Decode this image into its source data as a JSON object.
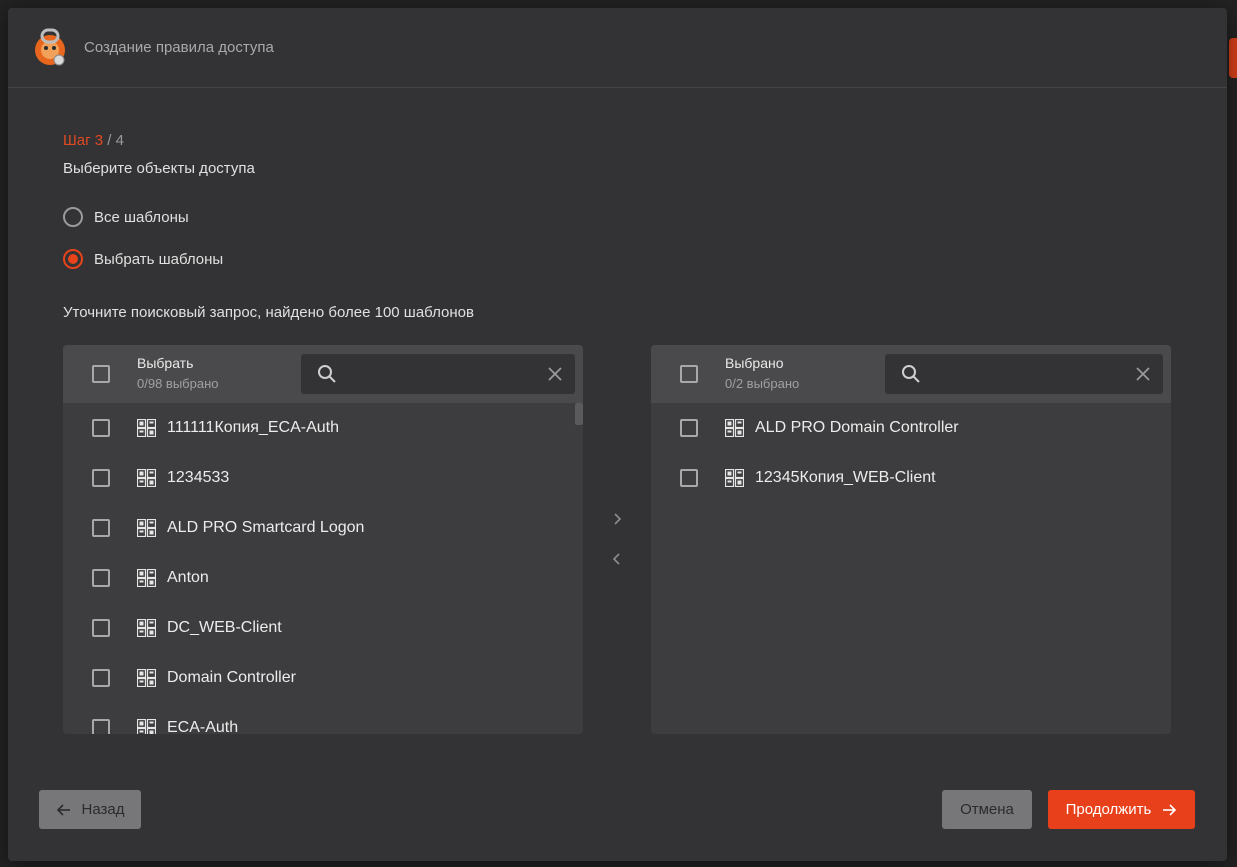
{
  "dialog": {
    "title": "Создание правила доступа"
  },
  "wizard": {
    "step_current": "Шаг 3",
    "step_total": " / 4",
    "subtitle": "Выберите объекты доступа"
  },
  "mode": {
    "options": [
      {
        "label": "Все шаблоны",
        "checked": false
      },
      {
        "label": "Выбрать шаблоны",
        "checked": true
      }
    ]
  },
  "hint": "Уточните поисковый запрос, найдено более 100 шаблонов",
  "left_panel": {
    "title": "Выбрать",
    "count": "0/98 выбрано",
    "search_value": "",
    "items": [
      "111111Копия_ECA-Auth",
      "1234533",
      "ALD PRO Smartcard Logon",
      "Anton",
      "DC_WEB-Client",
      "Domain Controller",
      "ECA-Auth"
    ]
  },
  "right_panel": {
    "title": "Выбрано",
    "count": "0/2 выбрано",
    "search_value": "",
    "items": [
      "ALD PRO Domain Controller",
      "12345Копия_WEB-Client"
    ]
  },
  "footer": {
    "back_label": "Назад",
    "cancel_label": "Отмена",
    "next_label": "Продолжить"
  },
  "colors": {
    "accent": "#e8401a",
    "modal_bg": "#333335",
    "panel_bg": "#3d3d3f"
  }
}
